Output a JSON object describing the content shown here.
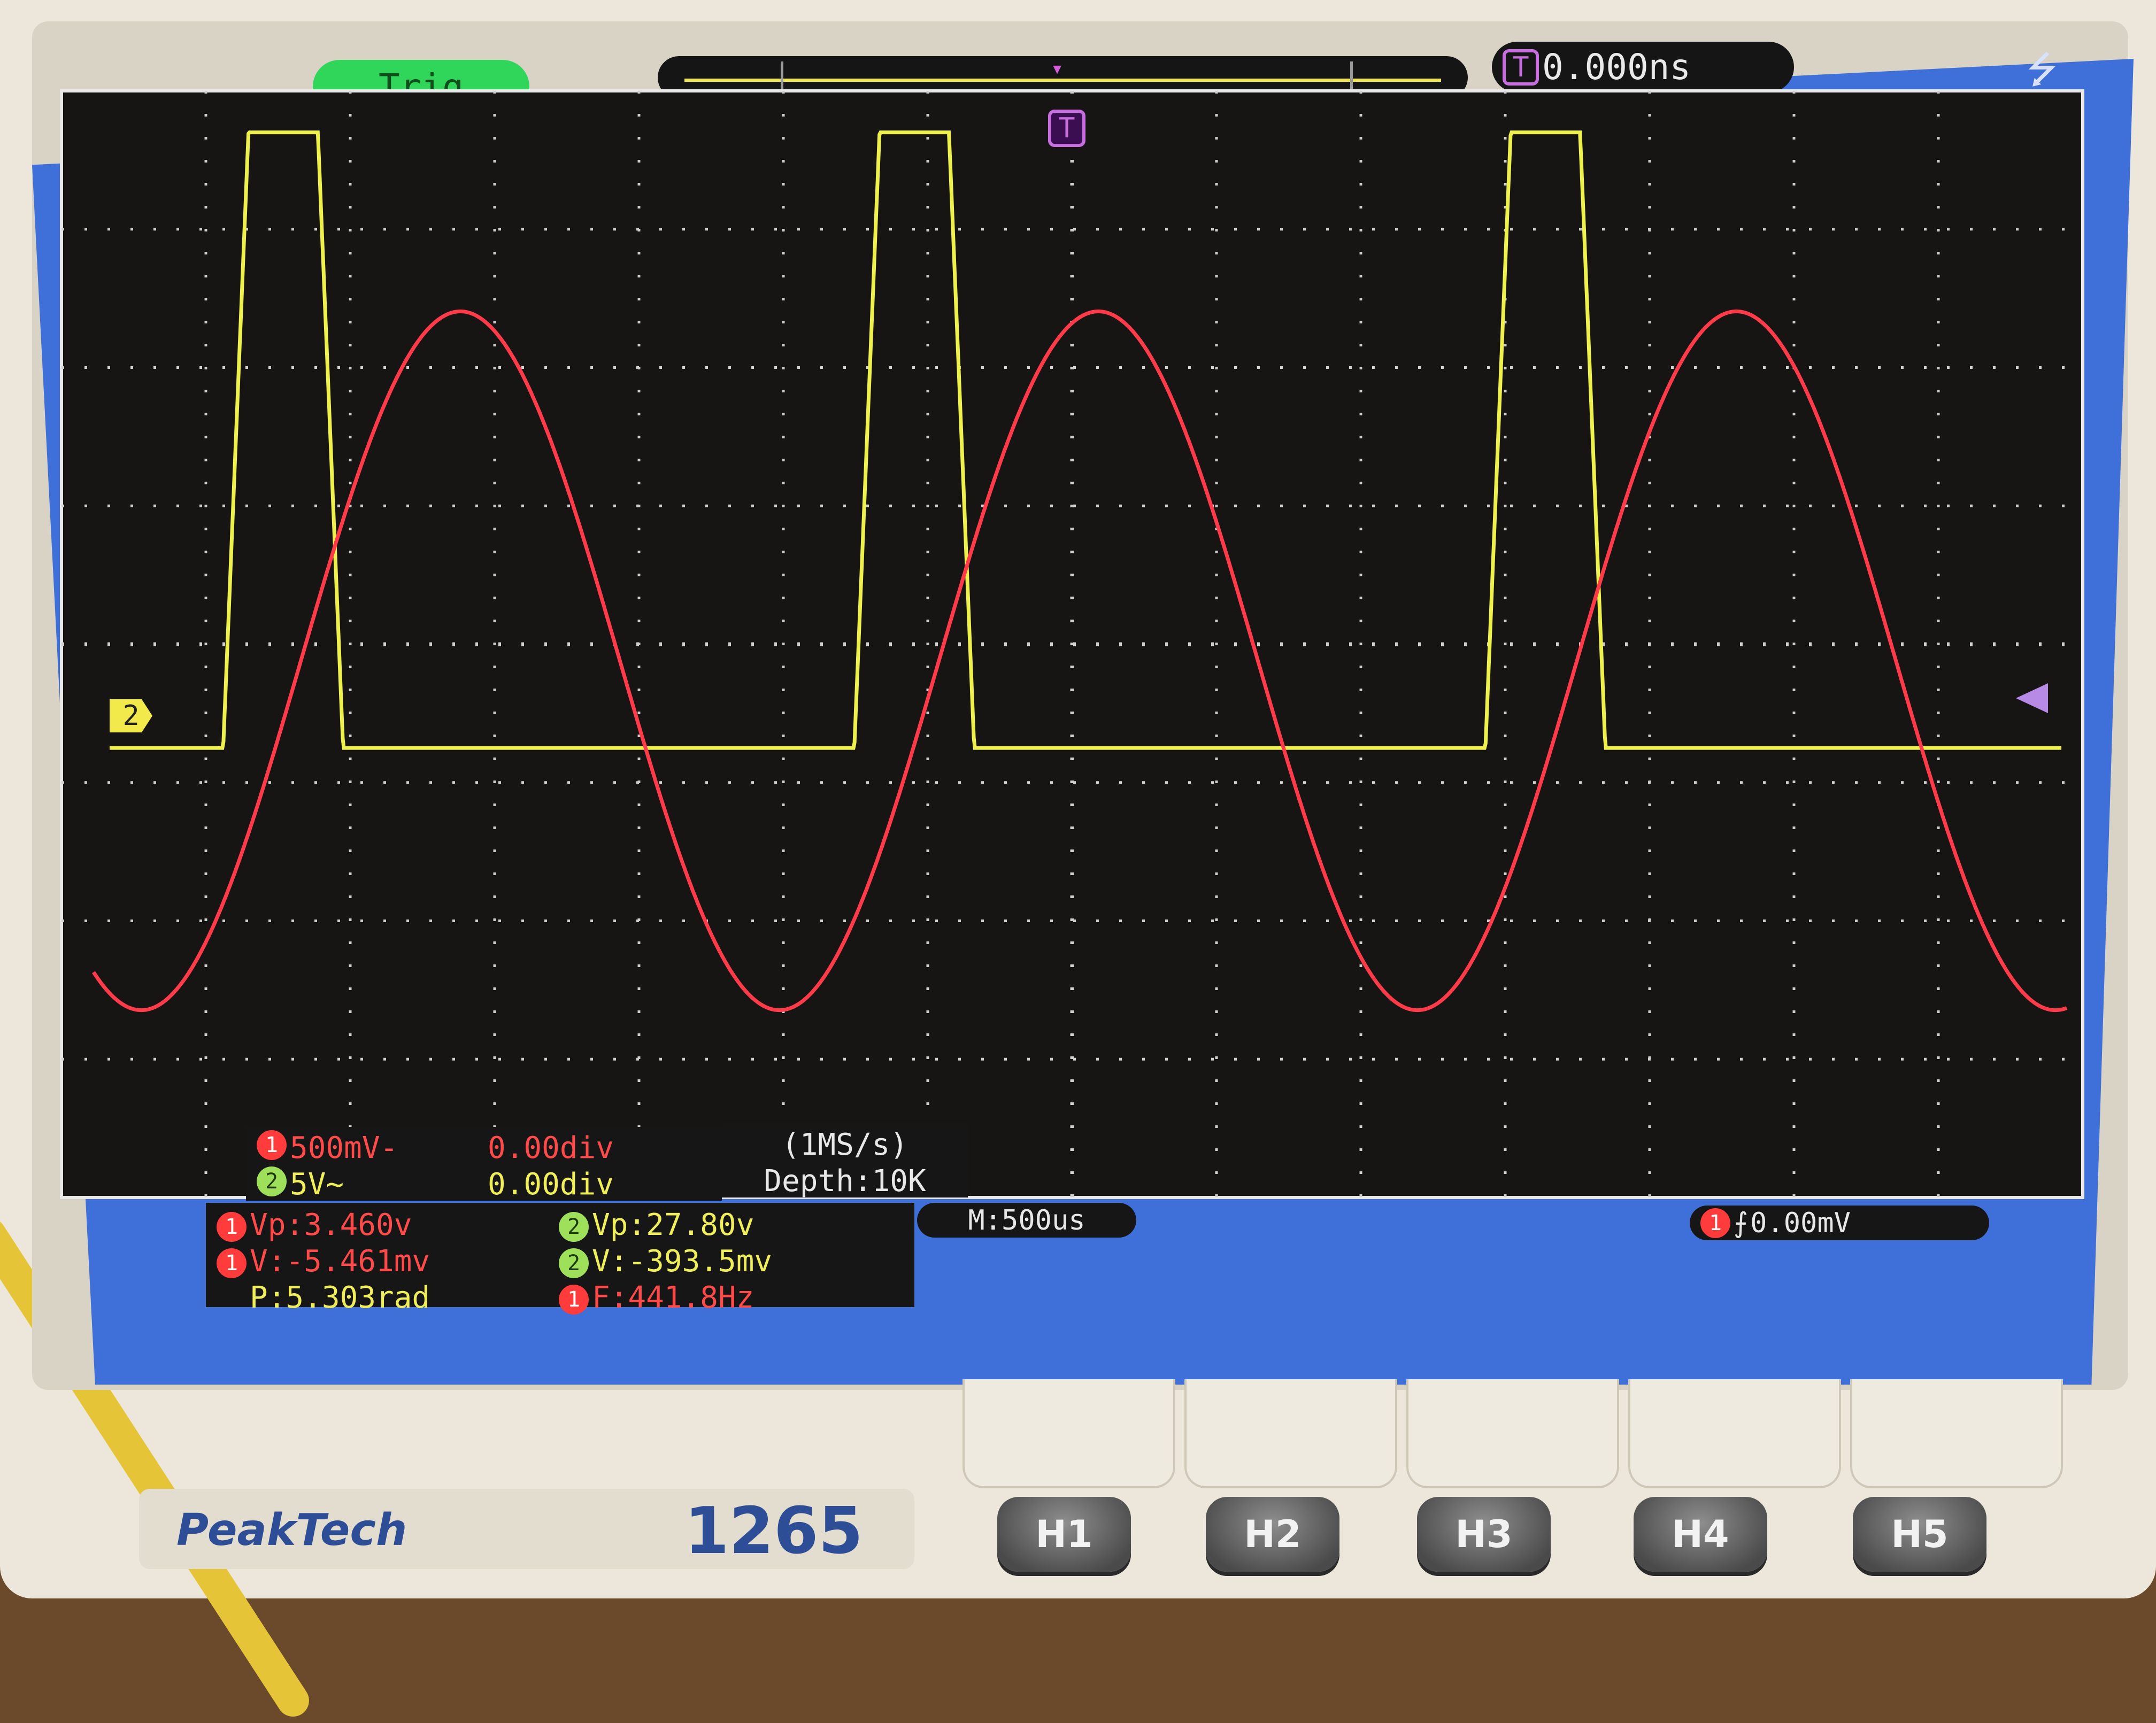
{
  "device": {
    "brand": "PeakTech",
    "model": "1265"
  },
  "status_bar": {
    "trigger_state": "Trig",
    "trigger_offset": "0.000ns",
    "trigger_t_icon": "T"
  },
  "markers": {
    "ch2_marker": "2",
    "top_trigger_marker": "T"
  },
  "channel_settings": [
    {
      "num": "1",
      "scale": "500mV-",
      "offset": "0.00div"
    },
    {
      "num": "2",
      "scale": "5V~",
      "offset": "0.00div"
    }
  ],
  "acquisition": {
    "rate": "(1MS/s)",
    "depth": "Depth:10K"
  },
  "measurements": [
    {
      "num": "1",
      "text": "Vp:3.460v",
      "color": "red"
    },
    {
      "num": "2",
      "text": "Vp:27.80v",
      "color": "green"
    },
    {
      "num": "1",
      "text": "V:-5.461mv",
      "color": "red"
    },
    {
      "num": "2",
      "text": "V:-393.5mv",
      "color": "green"
    },
    {
      "num": "",
      "text": "P:5.303rad",
      "color": "yellow"
    },
    {
      "num": "1",
      "text": "F:441.8Hz",
      "color": "red"
    }
  ],
  "timebase": "M:500us",
  "trigger": {
    "source": "1",
    "level": "0.00mV"
  },
  "buttons": [
    {
      "label": "H1"
    },
    {
      "label": "H2"
    },
    {
      "label": "H3"
    },
    {
      "label": "H4"
    },
    {
      "label": "H5"
    }
  ],
  "colors": {
    "ch1": "#ff3b4a",
    "ch2": "#eef04c",
    "screen_bg": "#3f6fd8",
    "grid_bg": "#171514"
  },
  "chart_data": {
    "type": "line",
    "grid": true,
    "x_divisions": 14,
    "y_divisions": 8,
    "x_unit_per_div": "500us",
    "series": [
      {
        "channel": "1",
        "wave": "sine",
        "peak_to_peak_v": 3.46,
        "frequency_hz": 441.8,
        "volts_per_div": 0.5
      },
      {
        "channel": "2",
        "wave": "square",
        "peak_to_peak_v": 27.8,
        "volts_per_div": 5
      }
    ]
  }
}
